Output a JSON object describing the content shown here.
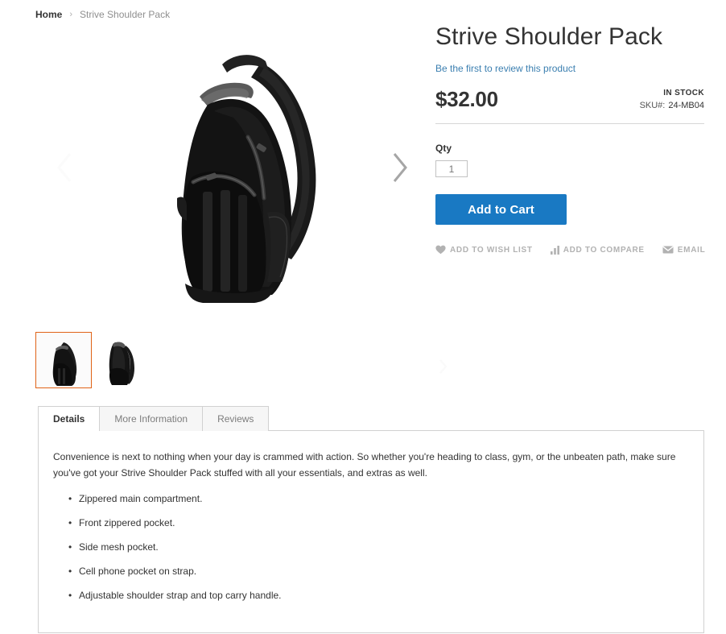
{
  "breadcrumb": {
    "home_label": "Home",
    "separator": "›",
    "current_label": "Strive Shoulder Pack"
  },
  "gallery": {
    "prev_arrow_icon": "chevron-left-icon",
    "next_arrow_icon": "chevron-right-icon",
    "thumb_next_icon": "chevron-right-icon",
    "thumbnails": [
      {
        "name": "Strive Shoulder Pack front view",
        "selected": true
      },
      {
        "name": "Strive Shoulder Pack side view",
        "selected": false
      }
    ],
    "selected_border_color": "#e06317"
  },
  "product": {
    "title": "Strive Shoulder Pack",
    "review_link": "Be the first to review this product",
    "review_link_color": "#3b7fb0",
    "price": "$32.00",
    "stock_status": "IN STOCK",
    "sku_label": "SKU#:",
    "sku_value": "24-MB04",
    "qty_label": "Qty",
    "qty_value": "1",
    "qty_placeholder": "1",
    "add_to_cart_label": "Add to Cart",
    "add_to_cart_color": "#1979c3"
  },
  "actions": [
    {
      "label": "Add to Wish List",
      "icon": "heart-icon"
    },
    {
      "label": "Add to Compare",
      "icon": "bar-chart-icon"
    },
    {
      "label": "Email",
      "icon": "envelope-icon"
    }
  ],
  "tabs": [
    {
      "label": "Details",
      "active": true
    },
    {
      "label": "More Information",
      "active": false
    },
    {
      "label": "Reviews",
      "active": false
    }
  ],
  "details": {
    "description": "Convenience is next to nothing when your day is crammed with action. So whether you're heading to class, gym, or the unbeaten path, make sure you've got your Strive Shoulder Pack stuffed with all your essentials, and extras as well.",
    "features": [
      "Zippered main compartment.",
      "Front zippered pocket.",
      "Side mesh pocket.",
      "Cell phone pocket on strap.",
      "Adjustable shoulder strap and top carry handle."
    ]
  }
}
